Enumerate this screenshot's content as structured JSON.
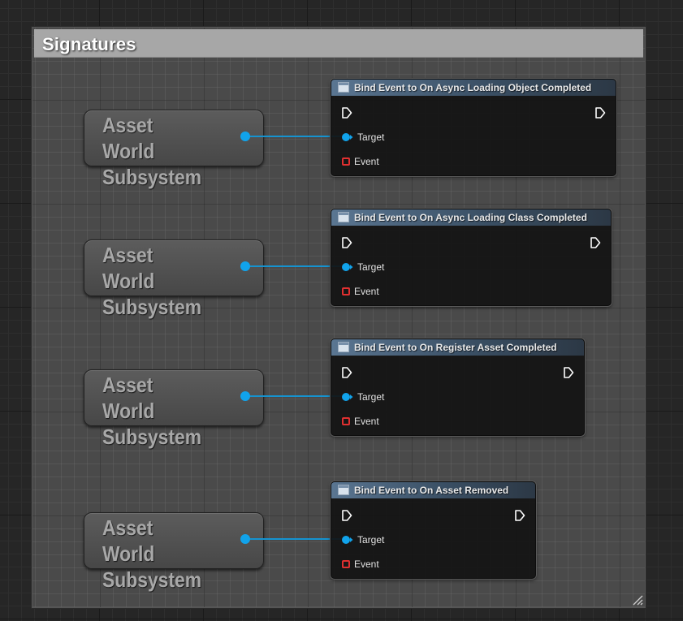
{
  "comment": {
    "title": "Signatures"
  },
  "rows": [
    {
      "variable_label": "Asset World\nSubsystem",
      "function_title": "Bind Event to On Async Loading Object Completed",
      "target_label": "Target",
      "event_label": "Event"
    },
    {
      "variable_label": "Asset World\nSubsystem",
      "function_title": "Bind Event to On Async Loading Class Completed",
      "target_label": "Target",
      "event_label": "Event"
    },
    {
      "variable_label": "Asset World\nSubsystem",
      "function_title": "Bind Event to On Register Asset Completed",
      "target_label": "Target",
      "event_label": "Event"
    },
    {
      "variable_label": "Asset World\nSubsystem",
      "function_title": "Bind Event to On Asset Removed",
      "target_label": "Target",
      "event_label": "Event"
    }
  ],
  "icons": {
    "function_node": "function-icon",
    "exec_pin": "exec-pin-icon",
    "object_pin": "object-pin-icon",
    "delegate_pin": "delegate-pin-icon",
    "resize_grip": "resize-grip-icon"
  },
  "colors": {
    "object_pin": "#11a3eb",
    "delegate_pin": "#e03030",
    "comment_header": "#a7a7a7",
    "function_header": "#5a7692"
  }
}
